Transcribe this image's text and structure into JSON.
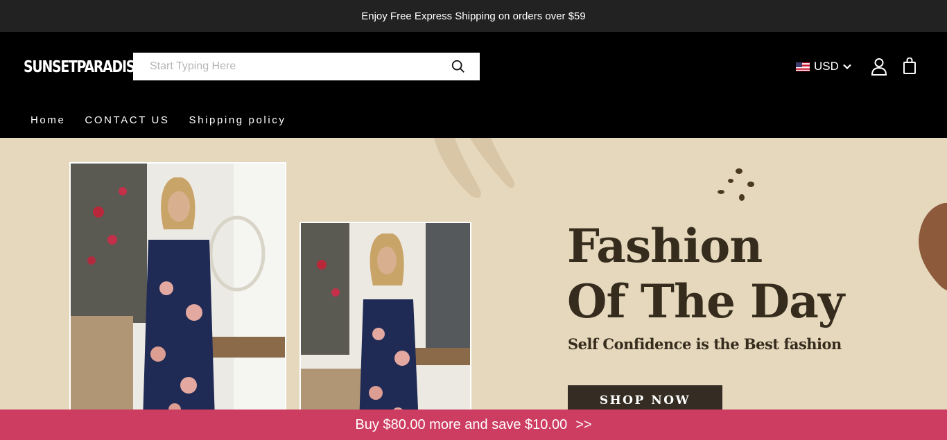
{
  "announcement": "Enjoy Free Express Shipping on orders over $59",
  "header": {
    "logo": "SUNSETPARADIS",
    "search_placeholder": "Start Typing Here",
    "currency": "USD"
  },
  "nav": {
    "items": [
      "Home",
      "CONTACT US",
      "Shipping policy"
    ]
  },
  "hero": {
    "title_line1": "Fashion",
    "title_line2": "Of The Day",
    "subtitle": "Self Confidence is the Best fashion",
    "button": "SHOP NOW"
  },
  "promo_bar": {
    "text": "Buy $80.00 more and save $10.00",
    "arrows": ">>"
  },
  "icons": [
    "search-icon",
    "us-flag-icon",
    "chevron-down-icon",
    "account-icon",
    "shopping-bag-icon"
  ],
  "colors": {
    "top_bar": "#222222",
    "header": "#000000",
    "hero_bg": "#e6d8bd",
    "hero_text": "#352c1d",
    "button": "#352c23",
    "promo_bar": "#cd3d61"
  }
}
